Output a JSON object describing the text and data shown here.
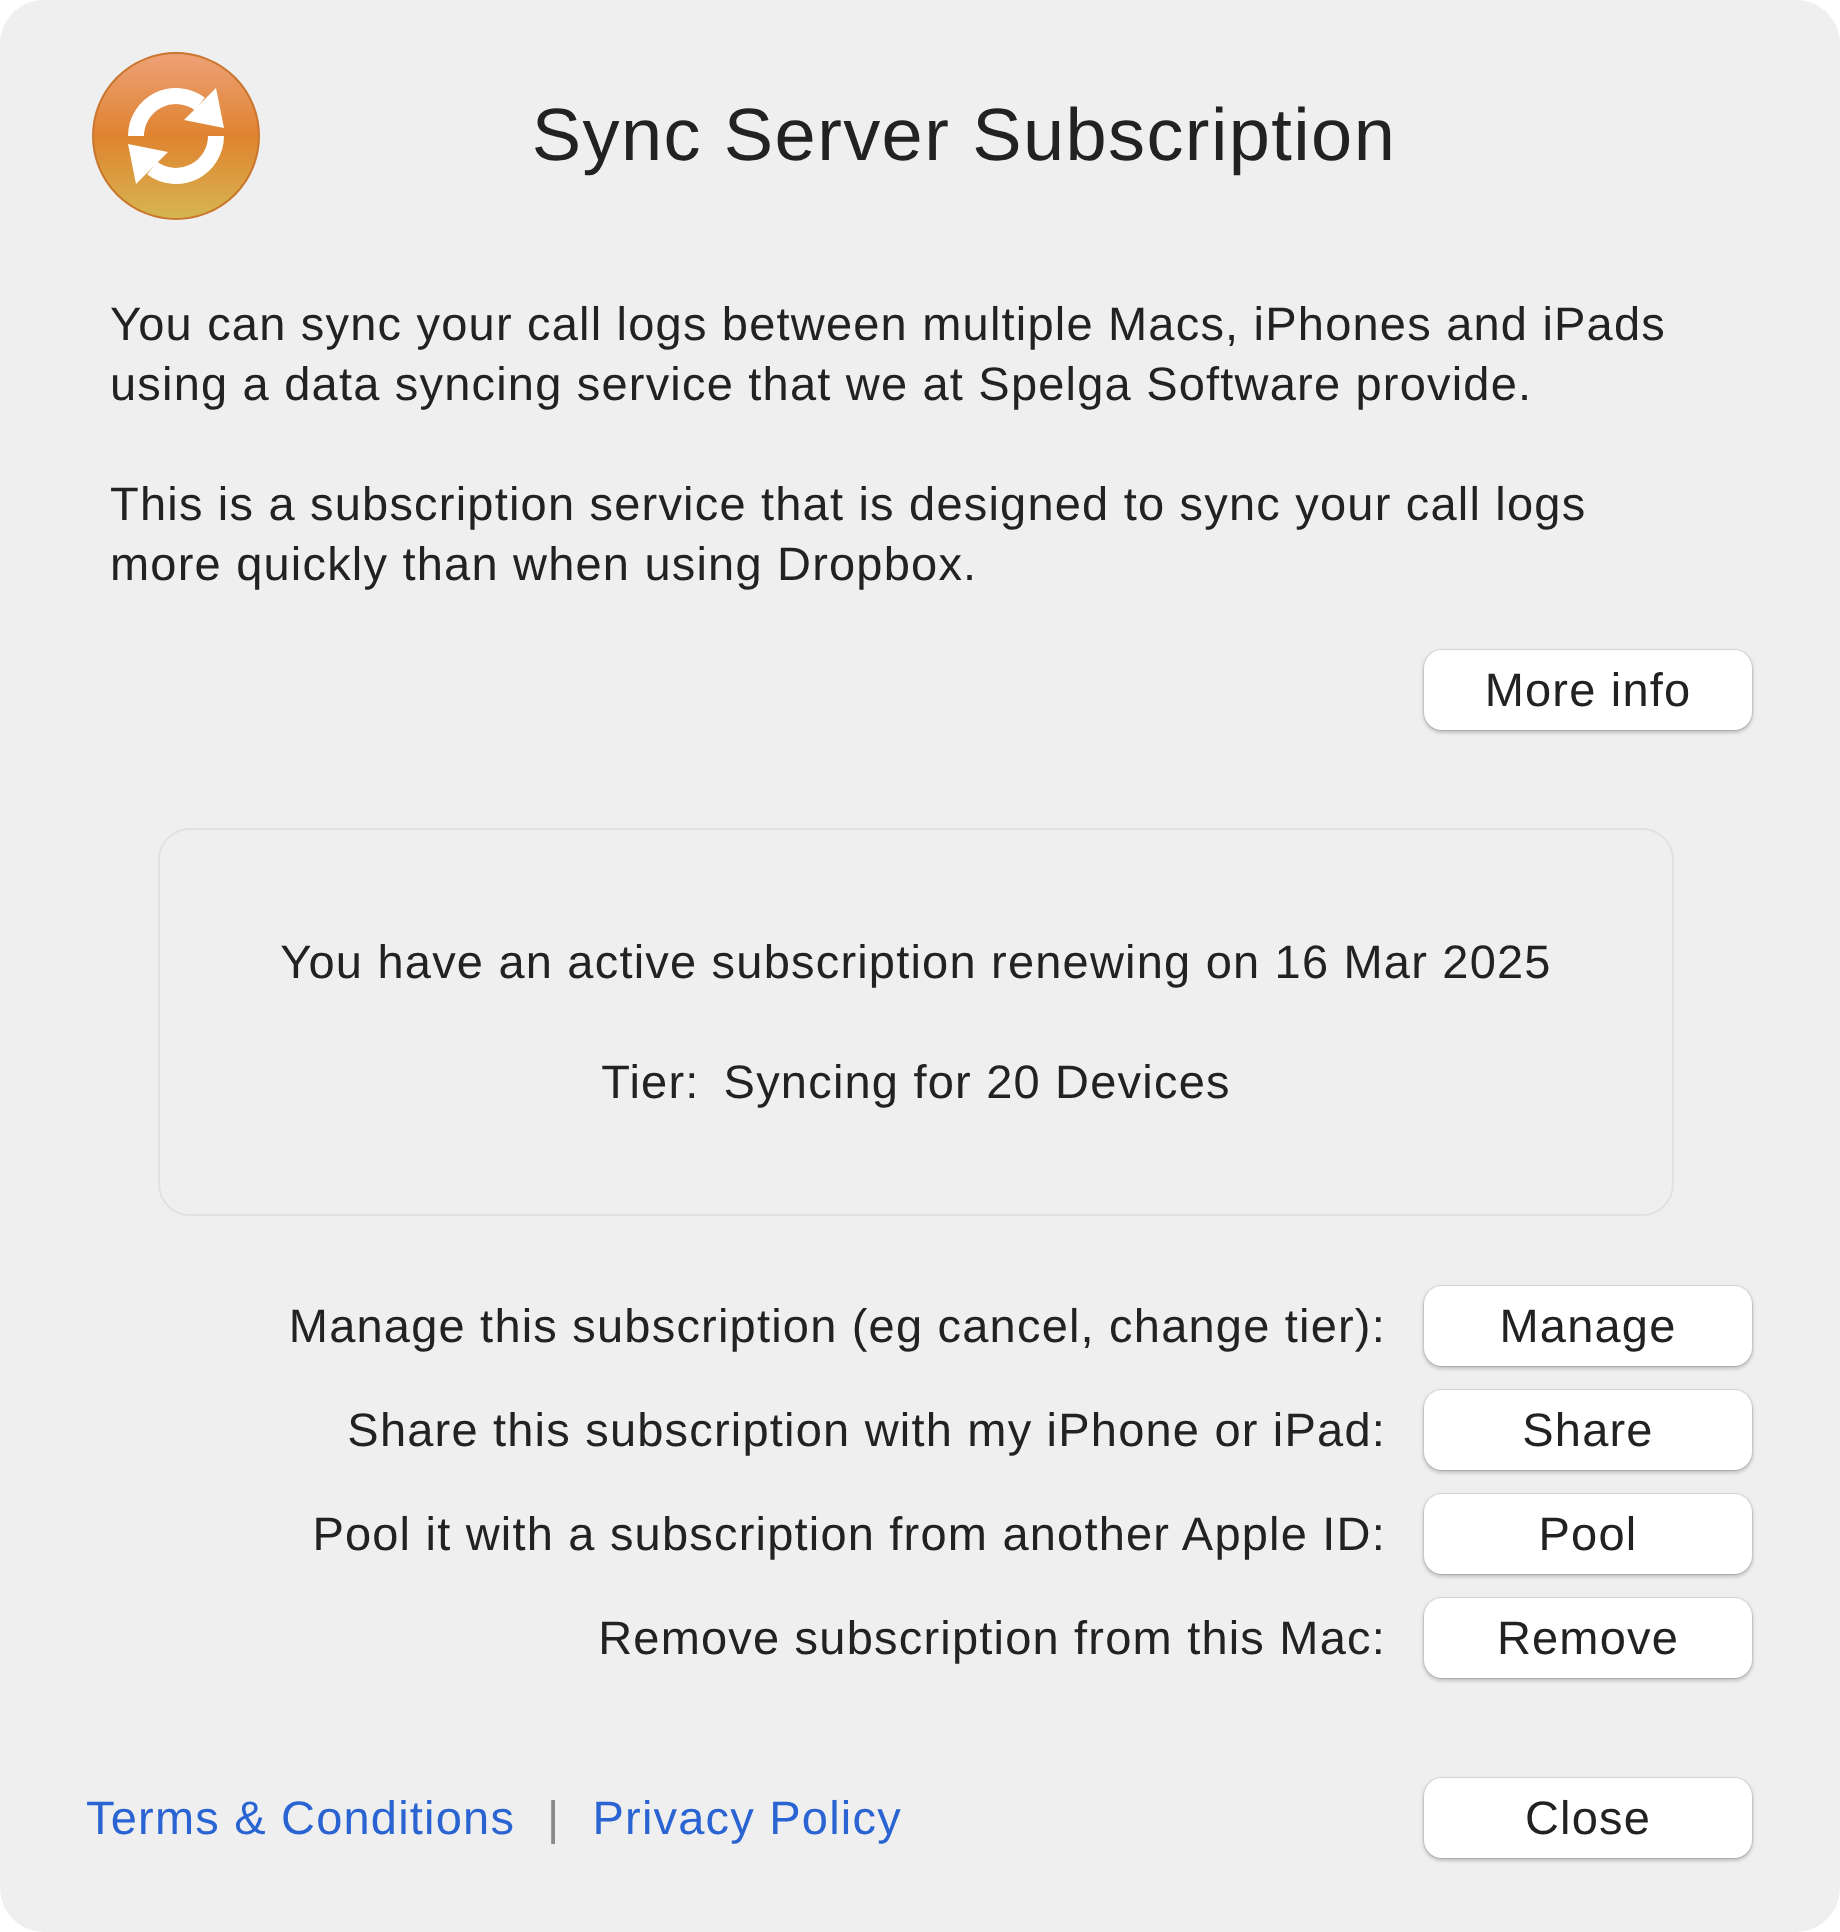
{
  "title": "Sync Server Subscription",
  "paragraphs": [
    "You can sync your call logs between multiple Macs, iPhones and iPads using a data syncing service that we at Spelga Software provide.",
    "This is a subscription service that is designed to sync your call logs more quickly than when using Dropbox."
  ],
  "more_info_button": "More info",
  "subscription": {
    "status": "You have an active subscription renewing on 16 Mar 2025",
    "tier_label": "Tier:",
    "tier_value": "Syncing for 20 Devices"
  },
  "actions": [
    {
      "label": "Manage this subscription (eg cancel, change tier):",
      "button": "Manage"
    },
    {
      "label": "Share this subscription with my iPhone or iPad:",
      "button": "Share"
    },
    {
      "label": "Pool it with a subscription from another Apple ID:",
      "button": "Pool"
    },
    {
      "label": "Remove subscription from this Mac:",
      "button": "Remove"
    }
  ],
  "footer": {
    "links": [
      "Terms & Conditions",
      "Privacy Policy"
    ],
    "separator": "|",
    "close_button": "Close"
  }
}
